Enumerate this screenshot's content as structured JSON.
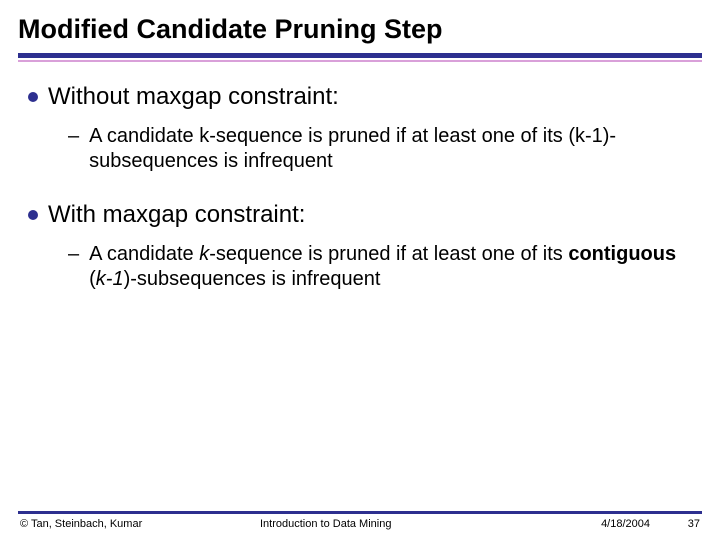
{
  "title": "Modified Candidate Pruning Step",
  "bullets": {
    "b1": {
      "text": "Without maxgap constraint:"
    },
    "b1sub": {
      "pre": "A candidate k-sequence is pruned if at least one of its (k-1)-subsequences is infrequent"
    },
    "b2": {
      "text": "With maxgap constraint:"
    },
    "b2sub": {
      "part1": "A candidate ",
      "k": "k",
      "part2": "-sequence is pruned if at least one of its ",
      "contig": "contiguous",
      "space": " (",
      "k1": "k-1",
      "part3": ")-subsequences is infrequent"
    }
  },
  "footer": {
    "left": "© Tan, Steinbach, Kumar",
    "center": "Introduction to Data Mining",
    "date": "4/18/2004",
    "page": "37"
  }
}
